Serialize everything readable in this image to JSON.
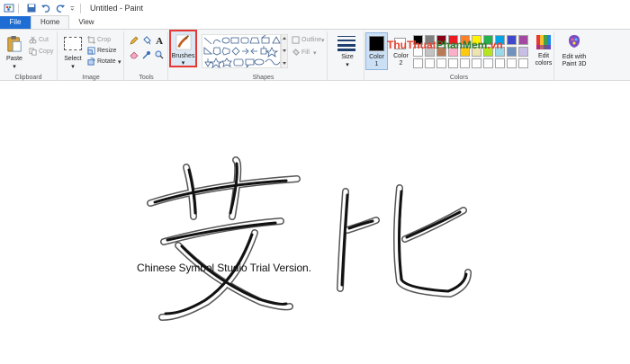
{
  "window": {
    "title": "Untitled - Paint"
  },
  "tabs": {
    "file": "File",
    "home": "Home",
    "view": "View"
  },
  "clipboard": {
    "paste": "Paste",
    "cut": "Cut",
    "copy": "Copy",
    "label": "Clipboard"
  },
  "image": {
    "select": "Select",
    "crop": "Crop",
    "resize": "Resize",
    "rotate": "Rotate",
    "label": "Image"
  },
  "tools": {
    "label": "Tools"
  },
  "brushes": {
    "label": "Brushes"
  },
  "shapes": {
    "outline": "Outline",
    "fill": "Fill",
    "label": "Shapes"
  },
  "size": {
    "label": "Size"
  },
  "colors": {
    "color1_label": "Color",
    "color1_num": "1",
    "color2_label": "Color",
    "color2_num": "2",
    "edit_colors_line1": "Edit",
    "edit_colors_line2": "colors",
    "label": "Colors",
    "palette_row1": [
      "#000000",
      "#7f7f7f",
      "#880015",
      "#ed1c24",
      "#ff7f27",
      "#fff200",
      "#22b14c",
      "#00a2e8",
      "#3f48cc",
      "#a349a4"
    ],
    "palette_row2": [
      "#ffffff",
      "#c3c3c3",
      "#b97a57",
      "#ffaec9",
      "#ffc90e",
      "#efe4b0",
      "#b5e61d",
      "#99d9ea",
      "#7092be",
      "#c8bfe7"
    ]
  },
  "paint3d": {
    "line1": "Edit with",
    "line2": "Paint 3D"
  },
  "brand": {
    "part1": "ThuThuat",
    "part2": "PhanMem",
    "part3": ".vn"
  },
  "canvas": {
    "watermark": "Chinese Symbol Studio Trial Version."
  },
  "accent": "#1e6dd4",
  "highlight": "#e53935"
}
